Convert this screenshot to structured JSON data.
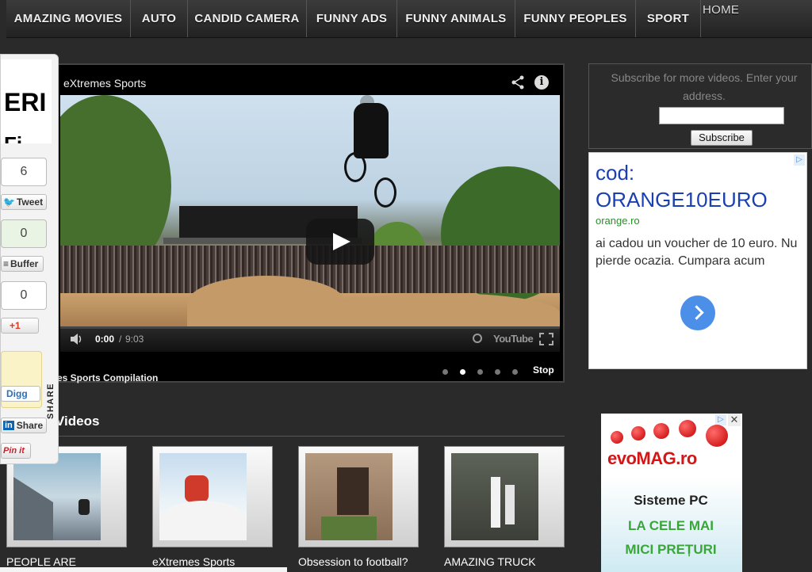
{
  "nav": {
    "items": [
      "AMAZING MOVIES",
      "AUTO",
      "CANDID CAMERA",
      "FUNNY ADS",
      "FUNNY ANIMALS",
      "FUNNY PEOPLES",
      "SPORT"
    ],
    "home": "HOME"
  },
  "player": {
    "title": "eXtremes Sports",
    "time_current": "0:00",
    "time_separator": "/",
    "time_total": "9:03",
    "youtube": "YouTube",
    "caption": "es Sports Compilation",
    "stop": "Stop",
    "progress_fraction": 0.0,
    "slide_active_index": 1,
    "slide_count": 5
  },
  "subscribe": {
    "text": "Subscribe for more videos. Enter your address.",
    "button": "Subscribe"
  },
  "ad_orange": {
    "line1": "cod:",
    "line2": "ORANGE10EURO",
    "domain": "orange.ro",
    "body": "ai cadou un voucher de 10 euro. Nu pierde ocazia. Cumpara acum",
    "badge": "▷"
  },
  "ad_evomag": {
    "logo": "evoMAG.ro",
    "line1": "Sisteme PC",
    "line2": "LA CELE MAI",
    "line3": "MICI PREȚURI",
    "close": "✕",
    "badge": "▷"
  },
  "videos": {
    "heading": "Videos",
    "items": [
      {
        "title": "PEOPLE ARE"
      },
      {
        "title": "eXtremes Sports"
      },
      {
        "title": "Obsession to football?"
      },
      {
        "title": "AMAZING TRUCK"
      }
    ]
  },
  "sidebar": {
    "logo_line1": "ERI",
    "logo_line2": "Fi",
    "counts": {
      "twitter": "6",
      "buffer": "0",
      "gplus": "0"
    },
    "buttons": {
      "tweet": "Tweet",
      "buffer": "Buffer",
      "gplus": "+1",
      "digg": "Digg",
      "linkedin": "Share",
      "pinterest": "Pin it"
    },
    "vertical_label": "SHARE"
  },
  "colors": {
    "nav_bg": "#2e2e2e",
    "ad_blue": "#1a3fb0",
    "ad_green": "#2e8b2e",
    "evomag_red": "#d71515",
    "evomag_green": "#3aa63a"
  }
}
